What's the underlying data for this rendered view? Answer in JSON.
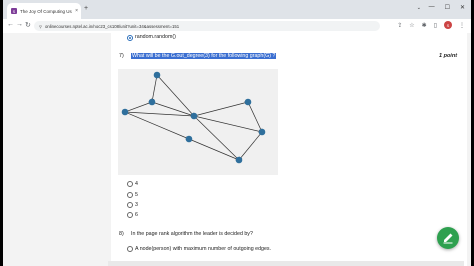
{
  "browser": {
    "tab_title": "The Joy Of Computing Using P...",
    "tab_close": "×",
    "new_tab": "+",
    "url": "onlinecourses.nptel.ac.in/noc23_cs108/unit?unit=34&assessment=151",
    "nav_back": "←",
    "nav_forward": "→",
    "nav_reload": "↻",
    "window_minimize": "—",
    "window_maximize": "☐",
    "window_close": "✕",
    "tab_search": "⌄",
    "toolbar_icons": {
      "share": "⇪",
      "star": "☆",
      "extensions": "✱",
      "sidebar": "▯",
      "menu": "⋮"
    },
    "avatar_initial": "S",
    "favicon_letter": "S"
  },
  "page": {
    "prev_option": "random.random()",
    "question7": {
      "number": "7)",
      "text": "What will be the G.out_degree(3) for the following graph(G) ?",
      "points": "1 point",
      "options": [
        "4",
        "5",
        "3",
        "6"
      ]
    },
    "question8": {
      "number": "8)",
      "text": "In the page rank algorithm the leader is decided by?",
      "options": [
        "A node(person) with maximum number of outgoing edges."
      ]
    }
  },
  "graph": {
    "node_color": "#2f6f9c",
    "edge_color": "#333333"
  },
  "colors": {
    "highlight": "#3b6fd1",
    "fab": "#2ea04f"
  },
  "icons": {
    "fab": "pencil-icon"
  }
}
